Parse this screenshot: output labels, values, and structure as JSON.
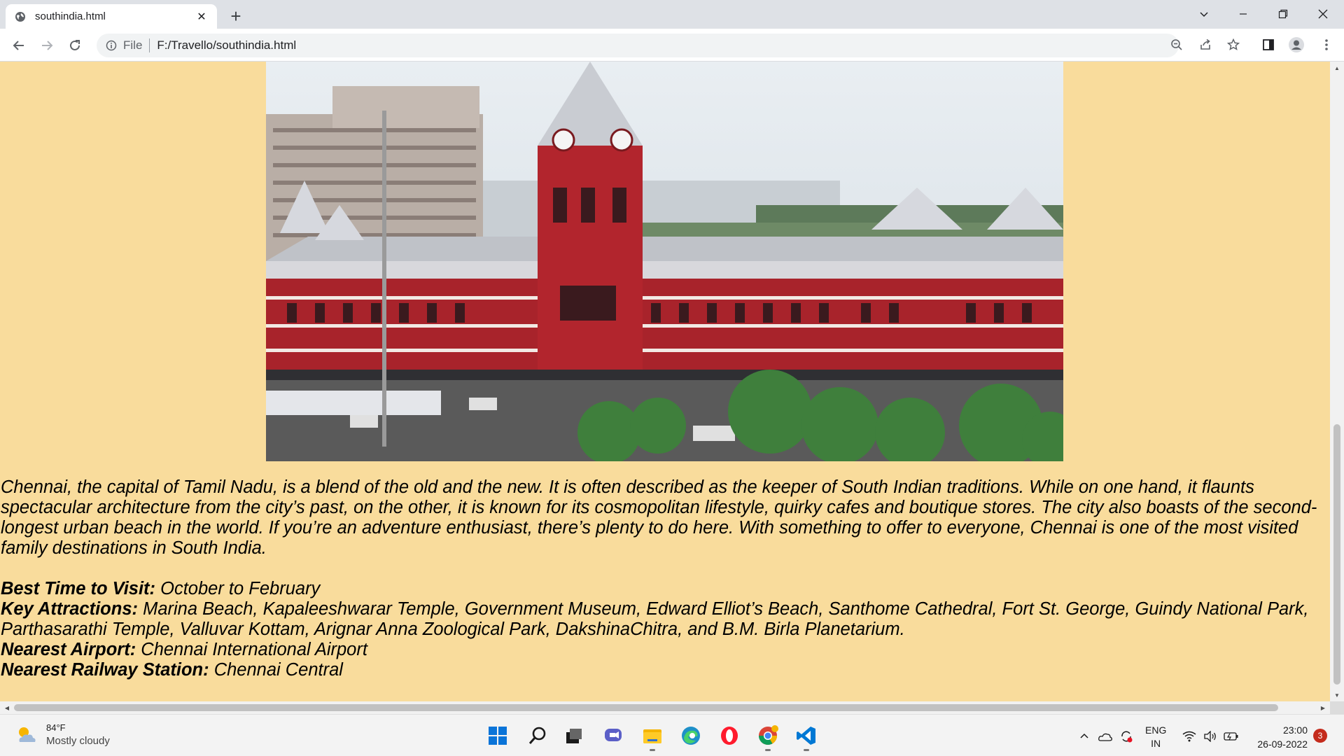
{
  "browser": {
    "tab_title": "southindia.html",
    "scheme_label": "File",
    "url": "F:/Travello/southindia.html"
  },
  "page": {
    "description": "Chennai, the capital of Tamil Nadu, is a blend of the old and the new. It is often described as the keeper of South Indian traditions. While on one hand, it flaunts spectacular architecture from the city’s past, on the other, it is known for its cosmopolitan lifestyle, quirky cafes and boutique stores. The city also boasts of the second-longest urban beach in the world. If you’re an adventure enthusiast, there’s plenty to do here. With something to offer to everyone, Chennai is one of the most visited family destinations in South India.",
    "facts": [
      {
        "label": "Best Time to Visit:",
        "value": " October to February"
      },
      {
        "label": "Key Attractions:",
        "value": " Marina Beach, Kapaleeshwarar Temple, Government Museum, Edward Elliot’s Beach, Santhome Cathedral, Fort St. George, Guindy National Park, Parthasarathi Temple, Valluvar Kottam, Arignar Anna Zoological Park, DakshinaChitra, and B.M. Birla Planetarium."
      },
      {
        "label": "Nearest Airport:",
        "value": " Chennai International Airport"
      },
      {
        "label": "Nearest Railway Station:",
        "value": " Chennai Central"
      }
    ]
  },
  "taskbar": {
    "weather_temp": "84°F",
    "weather_condition": "Mostly cloudy",
    "lang_line1": "ENG",
    "lang_line2": "IN",
    "time": "23:00",
    "date": "26-09-2022",
    "notification_count": "3"
  }
}
